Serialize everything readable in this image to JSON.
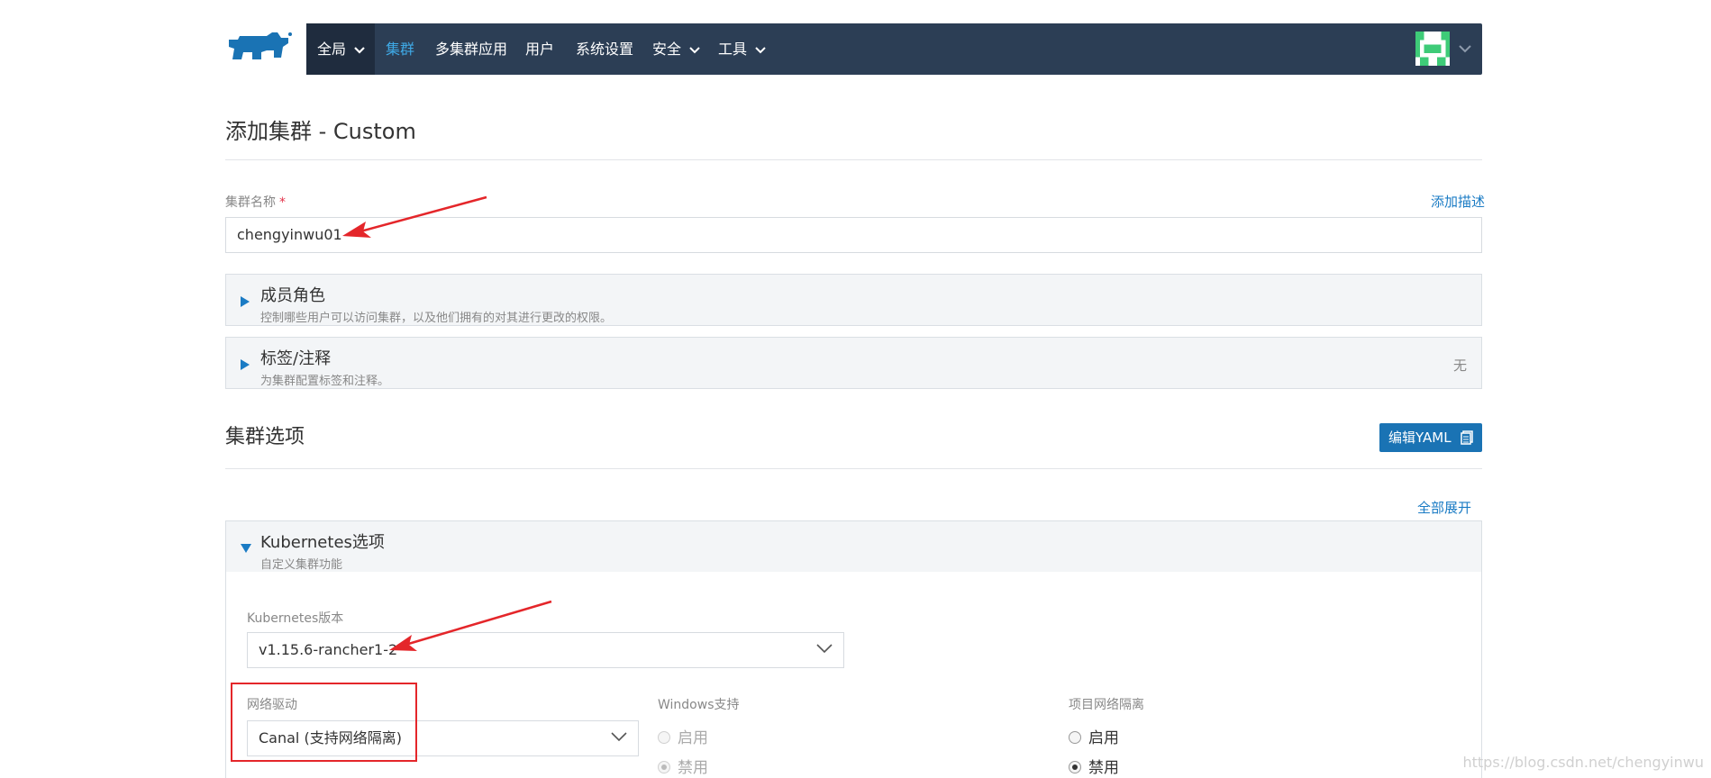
{
  "nav": {
    "global": "全局",
    "items": [
      "集群",
      "多集群应用",
      "用户",
      "系统设置",
      "安全",
      "工具"
    ]
  },
  "page": {
    "title": "添加集群 - Custom"
  },
  "cluster_name": {
    "label": "集群名称",
    "required_mark": "*",
    "value": "chengyinwu01",
    "add_desc": "添加描述"
  },
  "members": {
    "title": "成员角色",
    "subtitle": "控制哪些用户可以访问集群，以及他们拥有的对其进行更改的权限。"
  },
  "labels": {
    "title": "标签/注释",
    "subtitle": "为集群配置标签和注释。",
    "right": "无"
  },
  "cluster_options": {
    "title": "集群选项",
    "edit_yaml": "编辑YAML",
    "expand_all": "全部展开"
  },
  "k8s": {
    "title": "Kubernetes选项",
    "subtitle": "自定义集群功能",
    "version_label": "Kubernetes版本",
    "version_value": "v1.15.6-rancher1-2",
    "network_label": "网络驱动",
    "network_value": "Canal (支持网络隔离)",
    "windows_label": "Windows支持",
    "windows_enable": "启用",
    "windows_disable": "禁用",
    "isolation_label": "项目网络隔离",
    "isolation_enable": "启用",
    "isolation_disable": "禁用"
  },
  "watermark": "https://blog.csdn.net/chengyinwu",
  "colors": {
    "navbar": "#2c3e55",
    "accent": "#1a7bc4",
    "annotation": "#e4262a",
    "logo": "#1a73b4"
  }
}
